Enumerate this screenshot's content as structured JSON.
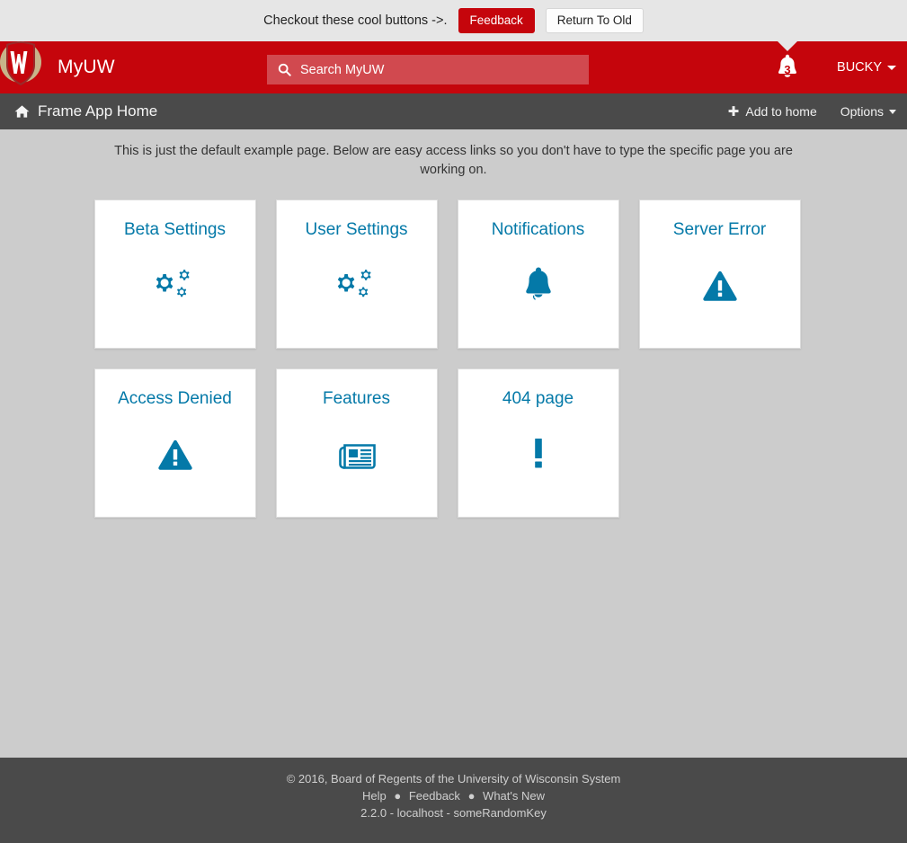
{
  "promo": {
    "text": "Checkout these cool buttons ->.",
    "feedback_label": "Feedback",
    "return_label": "Return To Old"
  },
  "brand": {
    "title": "MyUW",
    "logo_name": "uw-crest-logo",
    "search_placeholder": "Search MyUW",
    "search_value": "",
    "notification_count": "3",
    "user_label": "BUCKY"
  },
  "subheader": {
    "title": "Frame App Home",
    "add_to_home_label": "Add to home",
    "options_label": "Options"
  },
  "main": {
    "intro": "This is just the default example page. Below are easy access links so you don't have to type the specific page you are working on.",
    "cards": [
      {
        "title": "Beta Settings",
        "icon": "cogs-icon"
      },
      {
        "title": "User Settings",
        "icon": "cogs-icon"
      },
      {
        "title": "Notifications",
        "icon": "bell-icon"
      },
      {
        "title": "Server Error",
        "icon": "warning-triangle-icon"
      },
      {
        "title": "Access Denied",
        "icon": "warning-triangle-icon"
      },
      {
        "title": "Features",
        "icon": "newspaper-icon"
      },
      {
        "title": "404 page",
        "icon": "exclamation-icon"
      }
    ]
  },
  "footer": {
    "copyright": "© 2016, Board of Regents of the University of Wisconsin System",
    "links": [
      "Help",
      "Feedback",
      "What's New"
    ],
    "version": "2.2.0 - localhost - someRandomKey"
  },
  "colors": {
    "brand_red": "#c5050c",
    "accent_blue": "#0479a8",
    "dark_bar": "#4a4a4a",
    "page_bg": "#cccccc",
    "promo_bg": "#e6e6e6"
  }
}
